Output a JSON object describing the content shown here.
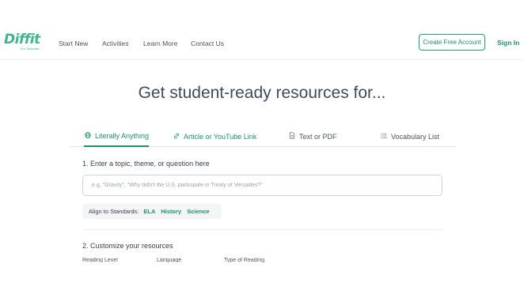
{
  "nav": {
    "logo": "Diffit",
    "logo_sub": "For Teachers",
    "links": [
      "Start New",
      "Activities",
      "Learn More",
      "Contact Us"
    ],
    "create_account": "Create Free Account",
    "sign_in": "Sign In"
  },
  "hero": {
    "title": "Get student-ready resources for..."
  },
  "tabs": [
    {
      "label": "Literally Anything",
      "icon": "globe-icon"
    },
    {
      "label": "Article or YouTube Link",
      "icon": "link-icon"
    },
    {
      "label": "Text or PDF",
      "icon": "document-icon"
    },
    {
      "label": "Vocabulary List",
      "icon": "list-icon"
    }
  ],
  "step1": {
    "label": "1. Enter a topic, theme, or question here",
    "placeholder": "e.g. \"Gravity\", \"Why didn't the U.S. participate in Treaty of Versailles?\"",
    "value": ""
  },
  "standards": {
    "label": "Align to Standards:",
    "items": [
      "ELA",
      "History",
      "Science"
    ]
  },
  "step2": {
    "label": "2. Customize your resources",
    "fields": [
      "Reading Level",
      "Language",
      "Type of Reading"
    ]
  },
  "colors": {
    "brand": "#3fb58a",
    "accent": "#1e8f6d"
  }
}
